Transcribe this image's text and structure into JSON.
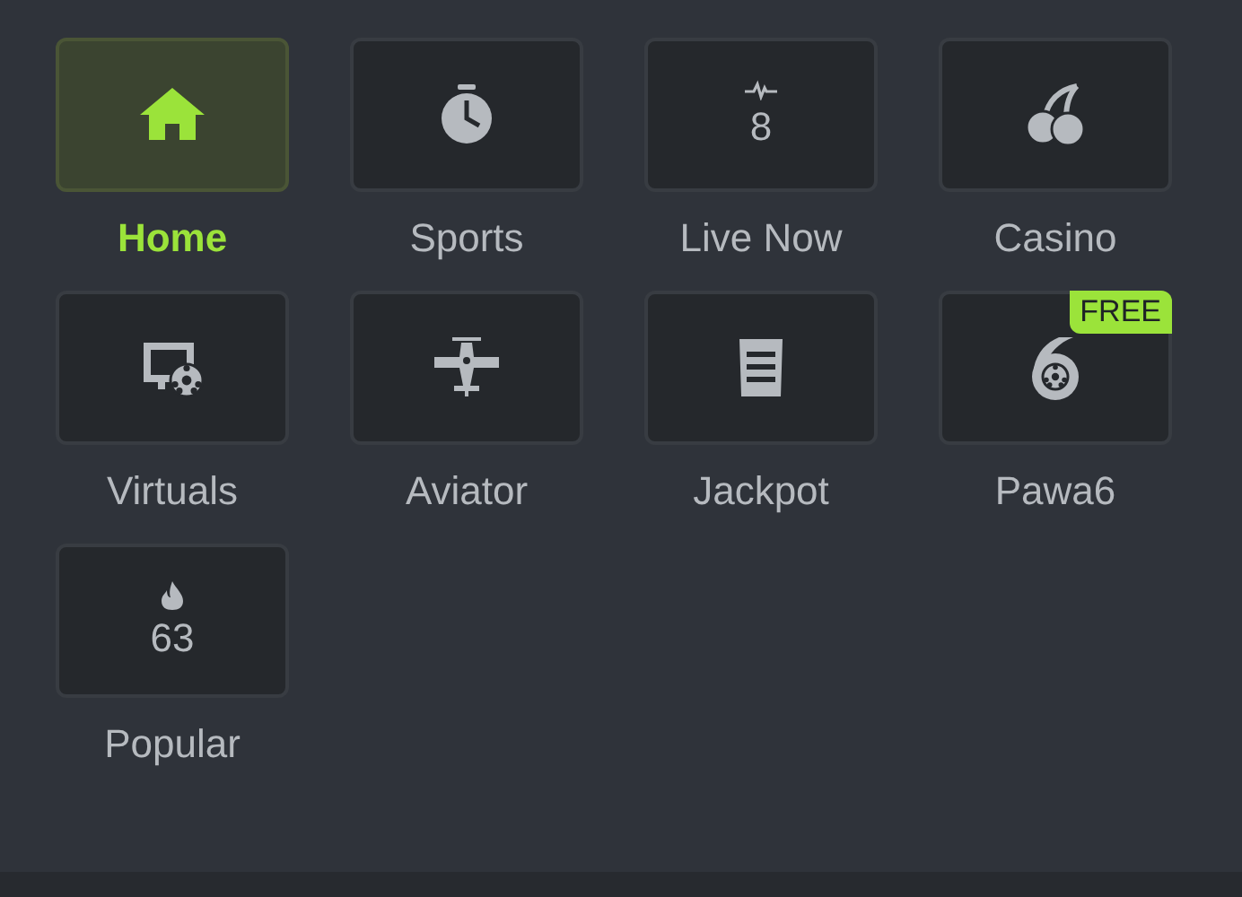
{
  "menu": [
    {
      "label": "Home",
      "selected": true
    },
    {
      "label": "Sports",
      "selected": false
    },
    {
      "label": "Live Now",
      "selected": false,
      "count": "8"
    },
    {
      "label": "Casino",
      "selected": false
    },
    {
      "label": "Virtuals",
      "selected": false
    },
    {
      "label": "Aviator",
      "selected": false
    },
    {
      "label": "Jackpot",
      "selected": false
    },
    {
      "label": "Pawa6",
      "selected": false,
      "badge": "FREE"
    },
    {
      "label": "Popular",
      "selected": false,
      "count": "63"
    }
  ]
}
